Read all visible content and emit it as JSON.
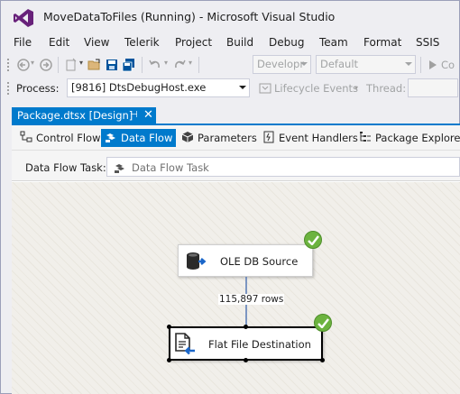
{
  "window": {
    "title": "MoveDataToFiles (Running) - Microsoft Visual Studio"
  },
  "menu": {
    "items": [
      "File",
      "Edit",
      "View",
      "Telerik",
      "Project",
      "Build",
      "Debug",
      "Team",
      "Format",
      "SSIS"
    ]
  },
  "toolbar": {
    "config_combo": "Developr",
    "platform_combo": "Default",
    "continue_label": "Co"
  },
  "debug_bar": {
    "process_label": "Process:",
    "process_value": "[9816] DtsDebugHost.exe",
    "lifecycle_label": "Lifecycle Events",
    "thread_label": "Thread:"
  },
  "document_tab": {
    "label": "Package.dtsx [Design]",
    "pin_icon": "pin-icon",
    "close_icon": "close-icon"
  },
  "designer_tabs": {
    "items": [
      {
        "label": "Control Flow",
        "icon": "control-flow-icon",
        "selected": false
      },
      {
        "label": "Data Flow",
        "icon": "data-flow-icon",
        "selected": true
      },
      {
        "label": "Parameters",
        "icon": "parameters-icon",
        "selected": false
      },
      {
        "label": "Event Handlers",
        "icon": "event-handlers-icon",
        "selected": false
      },
      {
        "label": "Package Explorer",
        "icon": "package-explorer-icon",
        "selected": false
      }
    ]
  },
  "data_flow_task": {
    "label": "Data Flow Task:",
    "value": "Data Flow Task"
  },
  "components": {
    "source": {
      "label": "OLE DB Source",
      "status": "success"
    },
    "destination": {
      "label": "Flat File Destination",
      "status": "success"
    },
    "path": {
      "rows_label": "115,897 rows"
    }
  },
  "colors": {
    "accent": "#007acc",
    "success": "#6cb33f",
    "vs_purple": "#68217a"
  }
}
